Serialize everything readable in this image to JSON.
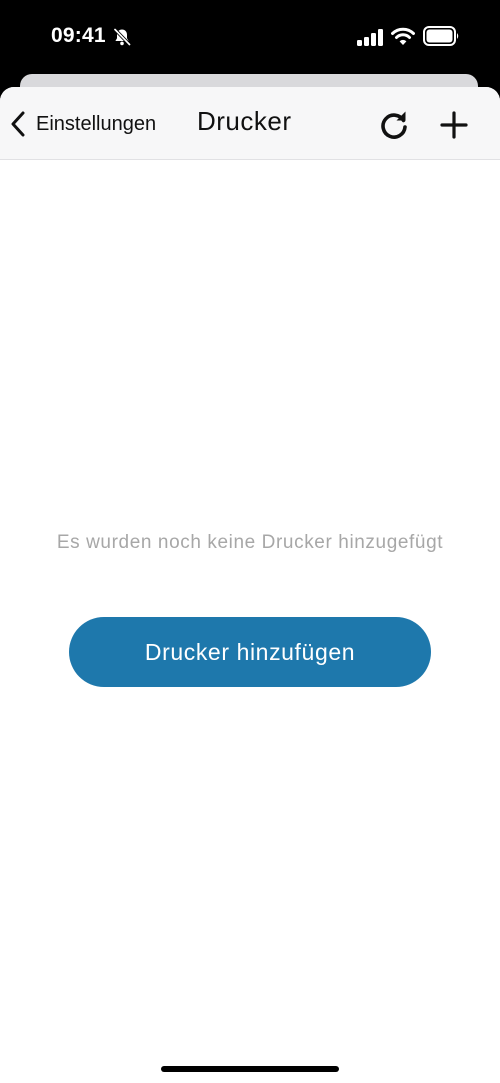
{
  "status_bar": {
    "time": "09:41"
  },
  "nav": {
    "back_label": "Einstellungen",
    "title": "Drucker"
  },
  "empty_state": {
    "message": "Es wurden noch keine Drucker hinzugefügt",
    "button_label": "Drucker hinzufügen"
  },
  "colors": {
    "accent": "#1e78ac",
    "muted_text": "#a7a7a7",
    "nav_background": "#f7f7f8"
  },
  "icons": {
    "status": [
      "bell-slash-icon",
      "cellular-signal-icon",
      "wifi-icon",
      "battery-icon"
    ],
    "nav": [
      "chevron-left-icon",
      "refresh-icon",
      "plus-icon"
    ]
  }
}
